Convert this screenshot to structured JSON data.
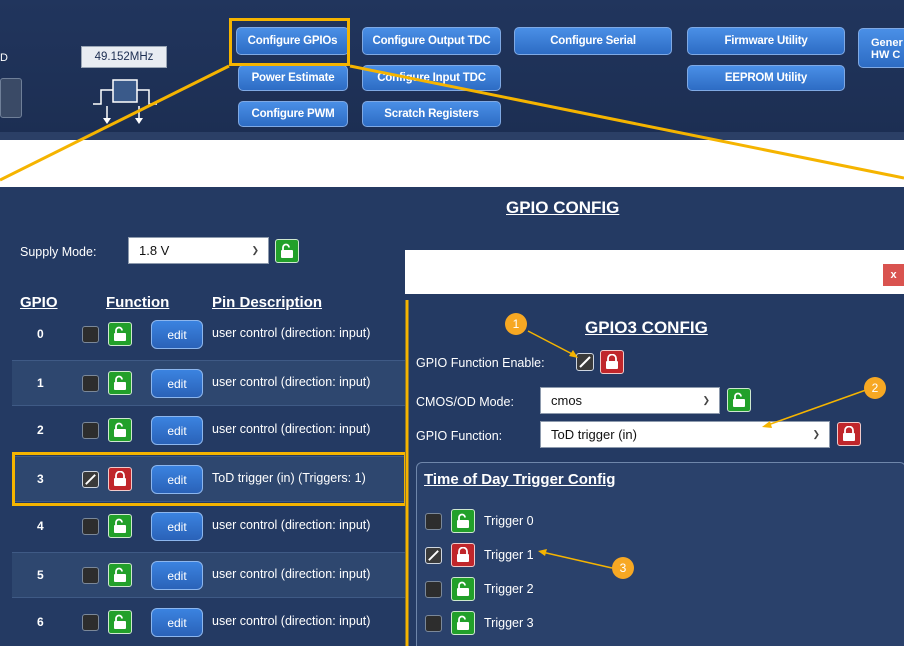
{
  "toolbar": {
    "frequency": "49.152MHz",
    "left_stub_text": "D",
    "buttons": {
      "configure_gpios": "Configure GPIOs",
      "configure_output_tdc": "Configure Output TDC",
      "configure_serial": "Configure Serial",
      "firmware_utility": "Firmware Utility",
      "power_estimate": "Power Estimate",
      "configure_input_tdc": "Configure Input TDC",
      "eeprom_utility": "EEPROM Utility",
      "configure_pwm": "Configure PWM",
      "scratch_registers": "Scratch Registers",
      "general_hw_config": "Gener HW C"
    }
  },
  "gpio_config": {
    "title": "GPIO CONFIG",
    "supply_mode_label": "Supply Mode:",
    "supply_mode_value": "1.8 V",
    "headers": {
      "gpio": "GPIO",
      "function": "Function",
      "pin_description": "Pin Description"
    },
    "edit_label": "edit",
    "rows": [
      {
        "gpio": "0",
        "enabled": false,
        "locked": false,
        "description": "user control (direction: input)"
      },
      {
        "gpio": "1",
        "enabled": false,
        "locked": false,
        "description": "user control (direction: input)"
      },
      {
        "gpio": "2",
        "enabled": false,
        "locked": false,
        "description": "user control (direction: input)"
      },
      {
        "gpio": "3",
        "enabled": true,
        "locked": true,
        "description": "ToD trigger (in) (Triggers: 1)"
      },
      {
        "gpio": "4",
        "enabled": false,
        "locked": false,
        "description": "user control (direction: input)"
      },
      {
        "gpio": "5",
        "enabled": false,
        "locked": false,
        "description": "user control (direction: input)"
      },
      {
        "gpio": "6",
        "enabled": false,
        "locked": false,
        "description": "user control (direction: input)"
      }
    ]
  },
  "gpio3_dialog": {
    "close_label": "x",
    "title": "GPIO3 CONFIG",
    "function_enable_label": "GPIO Function Enable:",
    "cmos_od_label": "CMOS/OD Mode:",
    "cmos_od_value": "cmos",
    "gpio_function_label": "GPIO Function:",
    "gpio_function_value": "ToD trigger (in)",
    "tod_title": "Time of Day Trigger Config",
    "triggers": [
      {
        "label": "Trigger 0",
        "enabled": false,
        "locked": false
      },
      {
        "label": "Trigger 1",
        "enabled": true,
        "locked": true
      },
      {
        "label": "Trigger 2",
        "enabled": false,
        "locked": false
      },
      {
        "label": "Trigger 3",
        "enabled": false,
        "locked": false
      }
    ]
  },
  "annotations": {
    "badges": [
      "1",
      "2",
      "3"
    ],
    "callout_color": "#f5b400",
    "badge_color": "#f7a823"
  },
  "colors": {
    "panel_bg": "#243a63",
    "lock_unlocked": "#22a02a",
    "lock_locked": "#c0262b",
    "button_blue": "#3b83e0"
  }
}
